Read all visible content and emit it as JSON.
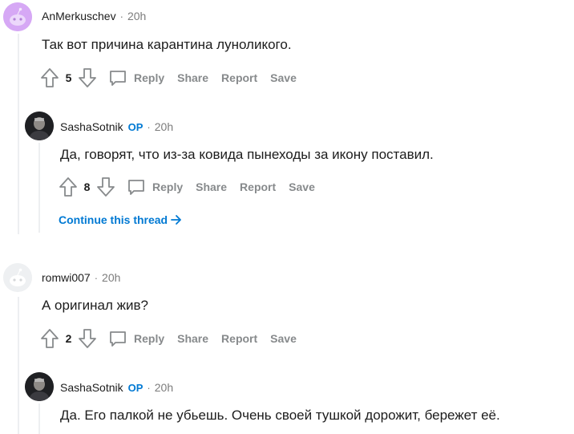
{
  "comments": [
    {
      "author": "AnMerkuschev",
      "op": "",
      "time": "20h",
      "text": "Так вот причина карантина луноликого.",
      "score": "5"
    },
    {
      "author": "SashaSotnik",
      "op": "OP",
      "time": "20h",
      "text": "Да, говорят, что из-за ковида пынеходы за икону поставил.",
      "score": "8"
    },
    {
      "author": "romwi007",
      "op": "",
      "time": "20h",
      "text": "А оригинал жив?",
      "score": "2"
    },
    {
      "author": "SashaSotnik",
      "op": "OP",
      "time": "20h",
      "text": "Да. Его палкой не убьешь. Очень своей тушкой дорожит, бережет её."
    }
  ],
  "actions": {
    "reply": "Reply",
    "share": "Share",
    "report": "Report",
    "save": "Save"
  },
  "continue_thread": "Continue this thread",
  "separator": "·",
  "colors": {
    "accent": "#0079d3",
    "muted": "#878a8c",
    "thread_line": "#edeff1",
    "avatar_purple": "#d6a8f5"
  },
  "icons": [
    "upvote-icon",
    "downvote-icon",
    "comment-bubble-icon",
    "arrow-right-icon",
    "snoo-avatar-icon"
  ]
}
